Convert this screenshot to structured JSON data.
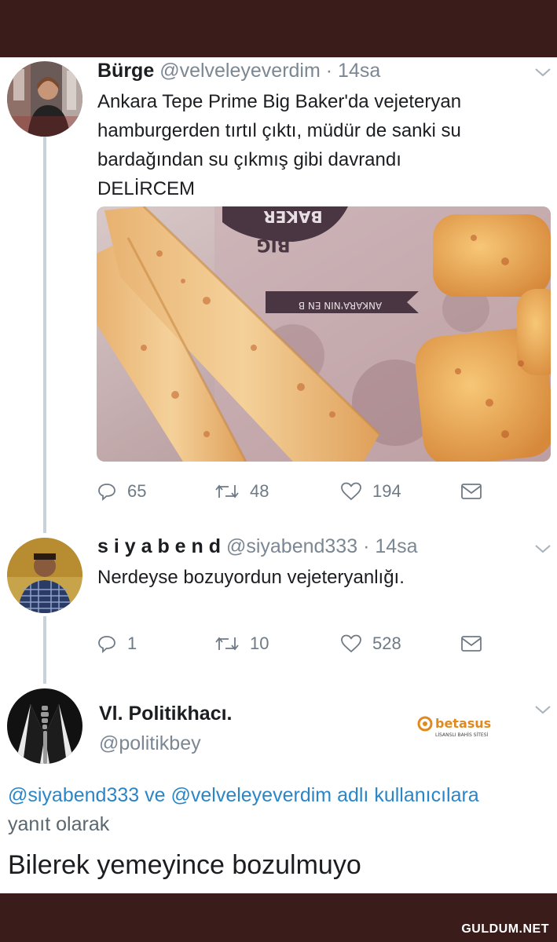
{
  "tweet1": {
    "name": "Bürge",
    "handle": "@velveleyeverdim",
    "time": "14sa",
    "lines": [
      "Ankara Tepe Prime Big Baker'da vejeteryan",
      "hamburgerden tırtıl çıktı, müdür de sanki su",
      "bardağından su çıkmış gibi davrandı",
      "DELİRCEM"
    ],
    "photo": {
      "wrapper_text_1": "BAKER",
      "wrapper_text_2": "BIG",
      "wrapper_text_3": "ANKARA'NIN EN B"
    },
    "stats": {
      "replies": "65",
      "retweets": "48",
      "likes": "194"
    }
  },
  "tweet2": {
    "name": "s i y a b e n d",
    "handle": "@siyabend333",
    "time": "14sa",
    "text": "Nerdeyse bozuyordun vejeteryanlığı.",
    "stats": {
      "replies": "1",
      "retweets": "10",
      "likes": "528"
    }
  },
  "tweet3": {
    "name": "Vl. Politikhacı.",
    "handle": "@politikbey",
    "reply_line1_mention1": "@siyabend333",
    "reply_line1_ve": "ve",
    "reply_line1_mention2": "@velveleyeverdim",
    "reply_line1_rest": "adlı kullanıcılara",
    "reply_line2": "yanıt olarak",
    "text": "Bilerek yemeyince bozulmuyo"
  },
  "watermark": {
    "brand": "betasus",
    "tagline": "LİSANSLI BAHİS SİTESİ"
  },
  "site": {
    "logo": "GULDUM.NET"
  },
  "colors": {
    "frame": "#3a1d1b",
    "mention": "#2a86c7",
    "secondary_text": "#7b8793",
    "icon": "#6e7a85",
    "thread_line": "#c7d2da"
  }
}
